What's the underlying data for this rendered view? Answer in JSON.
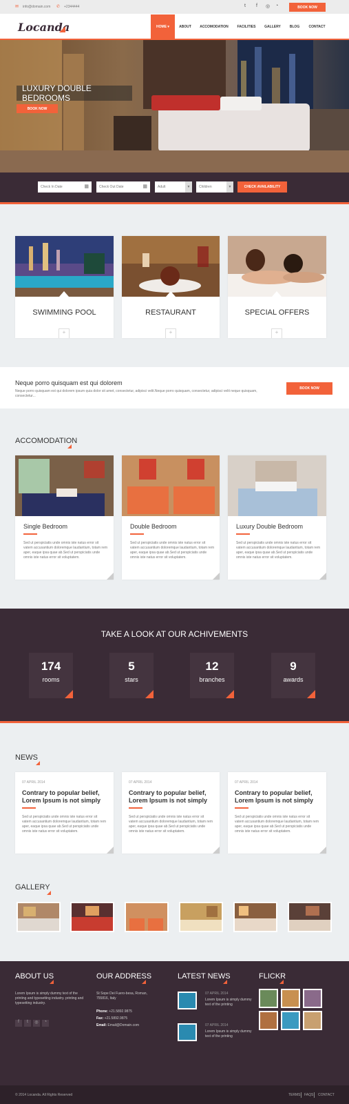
{
  "topbar": {
    "email": "info@domain.com",
    "phone": "+2344444",
    "book_now": "BOOK NOW"
  },
  "brand": {
    "logo": "Locanda",
    "accent": "#f2623a",
    "dark": "#3a2b36"
  },
  "nav": [
    {
      "label": "HOME ▾",
      "active": true
    },
    {
      "label": "ABOUT"
    },
    {
      "label": "ACCOMODATION"
    },
    {
      "label": "FACILITIES"
    },
    {
      "label": "GALLERY"
    },
    {
      "label": "BLOG"
    },
    {
      "label": "CONTACT"
    }
  ],
  "hero": {
    "title": "LUXURY DOUBLE BEDROOMS",
    "button": "BOOK NOW"
  },
  "booking": {
    "check_in": "Check In Date",
    "check_out": "Check Out Date",
    "adult": "Adult",
    "children": "Children",
    "submit": "CHECK AVAILABILITY"
  },
  "features": [
    {
      "title": "SWIMMING POOL"
    },
    {
      "title": "RESTAURANT"
    },
    {
      "title": "SPECIAL OFFERS"
    }
  ],
  "cta": {
    "title": "Neque porro quisquam est qui dolorem",
    "text": "Neque porro quisquam est qui dolorem ipsum quia dolor sit amet, consectetur, adipisci velit.Neque porro quisquam, consectetur, adipisci velit neque quisquam, consectetur...",
    "button": "BOOK NOW"
  },
  "accommodation": {
    "heading": "ACCOMODATION",
    "rooms": [
      {
        "title": "Single Bedroom",
        "text": "Sed ut perspiciatis unde omnis iste natus error sit vatem accusantium doloremque laudantium, totam rem aper, eaque ipsa quae ab.Sed ut perspiciatis unde omnis iste natus error sit voluptatem."
      },
      {
        "title": "Double Bedroom",
        "text": "Sed ut perspiciatis unde omnis iste natus error sit vatem accusantium doloremque laudantium, totam rem aper, eaque ipsa quae ab.Sed ut perspiciatis unde omnis iste natus error sit voluptatem."
      },
      {
        "title": "Luxury Double Bedroom",
        "text": "Sed ut perspiciatis unde omnis iste natus error sit vatem accusantium doloremque laudantium, totam rem aper, eaque ipsa quae ab.Sed ut perspiciatis unde omnis iste natus error sit voluptatem."
      }
    ]
  },
  "achievements": {
    "heading": "TAKE A LOOK AT OUR ACHIVEMENTS",
    "items": [
      {
        "num": "174",
        "label": "rooms"
      },
      {
        "num": "5",
        "label": "stars"
      },
      {
        "num": "12",
        "label": "branches"
      },
      {
        "num": "9",
        "label": "awards"
      }
    ]
  },
  "news": {
    "heading": "NEWS",
    "items": [
      {
        "date": "07 APRIL 2014",
        "title": "Contrary to popular belief, Lorem Ipsum is not simply",
        "text": "Sed ut perspiciatis unde omnis iste natus error sit vatem accusantium doloremque laudantium, totam rem aper, eaque ipsa quae ab.Sed ut perspiciatis unde omnis iste natus error sit voluptatem."
      },
      {
        "date": "07 APRIL 2014",
        "title": "Contrary to popular belief, Lorem Ipsum is not simply",
        "text": "Sed ut perspiciatis unde omnis iste natus error sit vatem accusantium doloremque laudantium, totam rem aper, eaque ipsa quae ab.Sed ut perspiciatis unde omnis iste natus error sit voluptatem."
      },
      {
        "date": "07 APRIL 2014",
        "title": "Contrary to popular belief, Lorem Ipsum is not simply",
        "text": "Sed ut perspiciatis unde omnis iste natus error sit vatem accusantium doloremque laudantium, totam rem aper, eaque ipsa quae ab.Sed ut perspiciatis unde omnis iste natus error sit voluptatem."
      }
    ]
  },
  "gallery": {
    "heading": "GALLERY"
  },
  "footer": {
    "about_title": "ABOUT US",
    "about_text": "Lorem Ipsum is simply dummy text of the printing and typesetting industry. printing and typesetting industry.",
    "address_title": "OUR ADDRESS",
    "address": "St Sope Dei Fuero-besa, Roman, 755816, Italy",
    "phone_label": "Phone:",
    "phone": "+21.5892.9875",
    "fax_label": "Fax:",
    "fax": "+21.5892.9875",
    "email_label": "Email:",
    "email": "Email@Domain.com",
    "news_title": "LATEST NEWS",
    "latest": [
      {
        "date": "07 APRIL 2014",
        "text": "Lorem Ipsum is simply dummy text of the printing"
      },
      {
        "date": "07 APRIL 2014",
        "text": "Lorem Ipsum is simply dummy text of the printing"
      }
    ],
    "flickr_title": "FLICKR"
  },
  "copyright": {
    "text": "© 2014 Locanda. All Rights Reserved",
    "terms": "TERMS",
    "faqs": "FAQS",
    "contact": "CONTACT"
  }
}
